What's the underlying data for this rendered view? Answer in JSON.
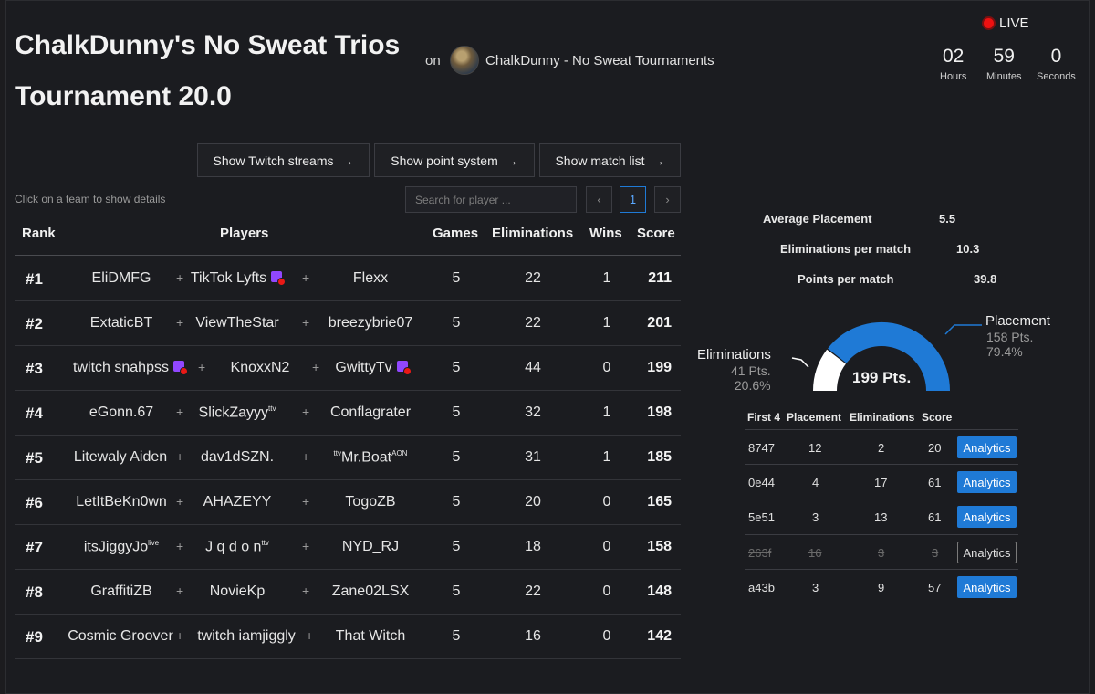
{
  "header": {
    "title_line1": "ChalkDunny's No Sweat Trios",
    "title_line2": "Tournament 20.0",
    "on_label": "on",
    "organizer": "ChalkDunny - No Sweat Tournaments",
    "live_label": "LIVE",
    "countdown": {
      "hours": "02",
      "hours_label": "Hours",
      "minutes": "59",
      "minutes_label": "Minutes",
      "seconds": "0",
      "seconds_label": "Seconds"
    }
  },
  "actions": {
    "twitch": "Show Twitch streams",
    "points": "Show point system",
    "matches": "Show match list",
    "arrow": "→"
  },
  "hint": "Click on a team to show details",
  "search": {
    "placeholder": "Search for player ..."
  },
  "pagination": {
    "prev": "‹",
    "page": "1",
    "next": "›"
  },
  "table": {
    "headers": {
      "rank": "Rank",
      "players": "Players",
      "games": "Games",
      "elims": "Eliminations",
      "wins": "Wins",
      "score": "Score"
    },
    "plus": "+",
    "rows": [
      {
        "rank": "#1",
        "p1": "EliDMFG",
        "p2": "TikTok Lyfts",
        "p3": "Flexx",
        "games": "5",
        "elims": "22",
        "wins": "1",
        "score": "211"
      },
      {
        "rank": "#2",
        "p1": "ExtaticBT",
        "p2": "ViewTheStar",
        "p3": "breezybrie07",
        "games": "5",
        "elims": "22",
        "wins": "1",
        "score": "201"
      },
      {
        "rank": "#3",
        "p1": "twitch snahpss",
        "p2": "KnoxxN2",
        "p3": "GwittyTv",
        "games": "5",
        "elims": "44",
        "wins": "0",
        "score": "199"
      },
      {
        "rank": "#4",
        "p1": "eGonn.67",
        "p2": "SlickZayyy",
        "p3": "Conflagrater",
        "games": "5",
        "elims": "32",
        "wins": "1",
        "score": "198"
      },
      {
        "rank": "#5",
        "p1": "Litewaly Aiden",
        "p2": "dav1dSZN.",
        "p3": "Mr.Boat",
        "games": "5",
        "elims": "31",
        "wins": "1",
        "score": "185"
      },
      {
        "rank": "#6",
        "p1": "LetItBeKn0wn",
        "p2": "AHAZEYY",
        "p3": "TogoZB",
        "games": "5",
        "elims": "20",
        "wins": "0",
        "score": "165"
      },
      {
        "rank": "#7",
        "p1": "itsJiggyJo",
        "p2": "J q d o n",
        "p3": "NYD_RJ",
        "games": "5",
        "elims": "18",
        "wins": "0",
        "score": "158"
      },
      {
        "rank": "#8",
        "p1": "GraffitiZB",
        "p2": "NovieKp",
        "p3": "Zane02LSX",
        "games": "5",
        "elims": "22",
        "wins": "0",
        "score": "148"
      },
      {
        "rank": "#9",
        "p1": "Cosmic Groover",
        "p2": "twitch iamjiggly",
        "p3": "That Witch",
        "games": "5",
        "elims": "16",
        "wins": "0",
        "score": "142"
      }
    ],
    "sups": {
      "ttv": "ttv",
      "live": "live",
      "aon": "AON"
    }
  },
  "details": {
    "stats": [
      {
        "label": "Average Placement",
        "value": "5.5"
      },
      {
        "label": "Eliminations per match",
        "value": "10.3"
      },
      {
        "label": "Points per match",
        "value": "39.8"
      }
    ],
    "gauge": {
      "total": "199 Pts.",
      "placement": {
        "title": "Placement",
        "pts": "158 Pts.",
        "pct": "79.4%",
        "fraction": 0.794
      },
      "eliminations": {
        "title": "Eliminations",
        "pts": "41 Pts.",
        "pct": "20.6%",
        "fraction": 0.206
      },
      "placement_color": "#1f7ad6",
      "elim_color": "#ffffff"
    },
    "matches": {
      "headers": {
        "id": "First 4",
        "placement": "Placement",
        "elims": "Eliminations",
        "score": "Score"
      },
      "analytics_label": "Analytics",
      "rows": [
        {
          "id": "8747",
          "placement": "12",
          "elims": "2",
          "score": "20"
        },
        {
          "id": "0e44",
          "placement": "4",
          "elims": "17",
          "score": "61"
        },
        {
          "id": "5e51",
          "placement": "3",
          "elims": "13",
          "score": "61"
        },
        {
          "id": "263f",
          "placement": "16",
          "elims": "3",
          "score": "3"
        },
        {
          "id": "a43b",
          "placement": "3",
          "elims": "9",
          "score": "57"
        }
      ]
    }
  }
}
